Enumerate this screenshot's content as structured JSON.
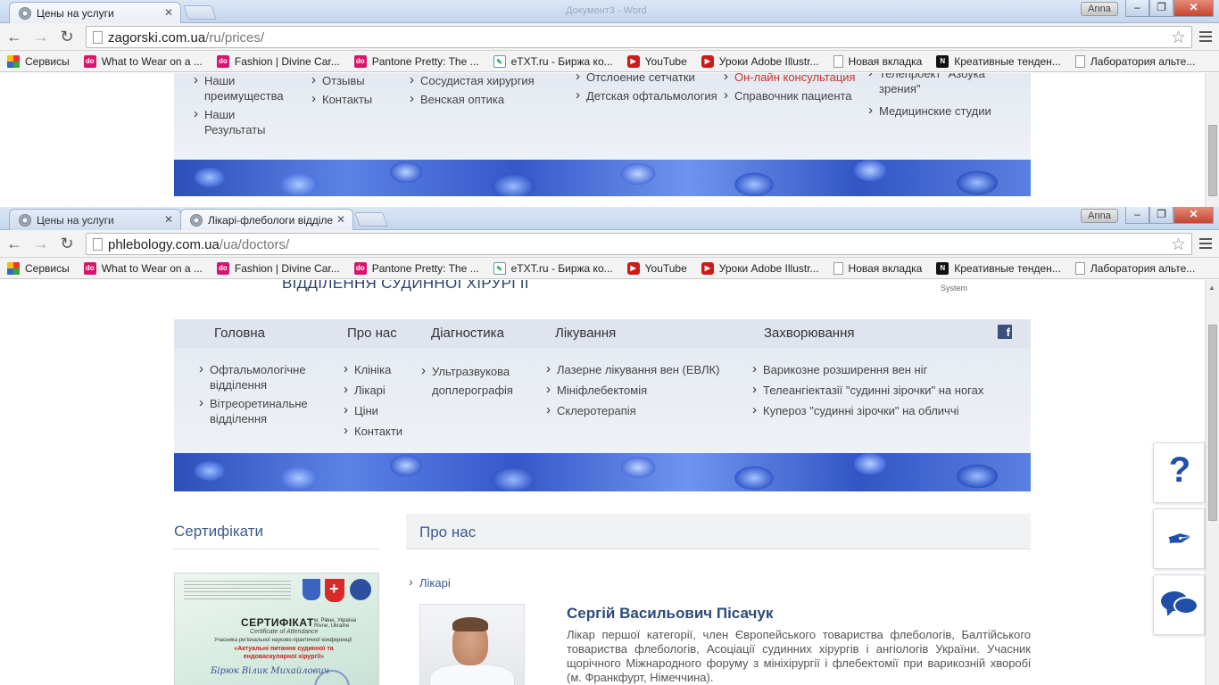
{
  "bookmarks": [
    {
      "label": "Сервисы",
      "icon": "apps-icon",
      "cls": "apps"
    },
    {
      "label": "What to Wear on a ...",
      "icon": "do-icon",
      "cls": "do"
    },
    {
      "label": "Fashion | Divine Car...",
      "icon": "do-icon",
      "cls": "do"
    },
    {
      "label": "Pantone Pretty: The ...",
      "icon": "do-icon",
      "cls": "do"
    },
    {
      "label": "eTXT.ru - Биржа ко...",
      "icon": "etxt-icon",
      "cls": "etxt"
    },
    {
      "label": "YouTube",
      "icon": "youtube-icon",
      "cls": "yt"
    },
    {
      "label": "Уроки Adobe Illustr...",
      "icon": "youtube-icon",
      "cls": "yt"
    },
    {
      "label": "Новая вкладка",
      "icon": "page-icon",
      "cls": "doc"
    },
    {
      "label": "Креативные тенден...",
      "icon": "n-icon",
      "cls": "n"
    },
    {
      "label": "Лаборатория альте...",
      "icon": "page-icon",
      "cls": "doc"
    }
  ],
  "window1": {
    "user": "Anna",
    "ghost_title": "Документ3 - Word",
    "tabs": [
      {
        "title": "Цены на услуги"
      }
    ],
    "url_host": "zagorski.com.ua",
    "url_path": "/ru/prices/",
    "menu": {
      "col1": [
        "Наши преимущества",
        "Наши Результаты"
      ],
      "col2": [
        "Отзывы",
        "Контакты"
      ],
      "col3": [
        "Сосудистая хирургия",
        "Венская оптика"
      ],
      "col4": [
        "Отслоение сетчатки",
        "Детская офтальмология"
      ],
      "col5": [
        "Он-лайн консультация",
        "Справочник пациента"
      ],
      "col6": [
        "Телепроект \"Азбука зрения\"",
        "Медицинские студии"
      ]
    }
  },
  "window2": {
    "user": "Anna",
    "tabs": [
      {
        "title": "Цены на услуги"
      },
      {
        "title": "Лікарі-флебологи відділе"
      }
    ],
    "url_host": "phlebology.com.ua",
    "url_path": "/ua/doctors/",
    "dept_title": "ВІДДІЛЕННЯ СУДИННОЇ ХІРУРГІЇ",
    "system_label": "System",
    "nav": [
      "Головна",
      "Про нас",
      "Діагностика",
      "Лікування",
      "Захворювання"
    ],
    "submenu": {
      "home": [
        "Офтальмологічне відділення",
        "Вітреоретинальне відділення"
      ],
      "about": [
        "Клініка",
        "Лікарі",
        "Ціни",
        "Контакти"
      ],
      "diagnostics": [
        "Ультразвукова доплерографія"
      ],
      "treatment": [
        "Лазерне лікування вен (ЕВЛК)",
        "Мініфлебектомія",
        "Склеротерапія"
      ],
      "diseases": [
        "Варикозне розширення вен ніг",
        "Телеангіектазії \"судинні зірочки\" на ногах",
        "Купероз \"судинні зірочки\" на обличчі"
      ]
    },
    "certificates_heading": "Сертифікати",
    "certificate": {
      "title": "СЕРТИФІКАТ",
      "subtitle": "Certificate of Attendance",
      "conference": "Учасника регіональної науково-практичної конференції",
      "topic": "«Актуальні питання судинної та ендоваскулярної хірургії»",
      "place": "м. Рівне, Україна Rivne, Ukraine",
      "signature": "Бірюк  Вілик  Михайлович"
    },
    "about_heading": "Про нас",
    "breadcrumb": "Лікарі",
    "doctor": {
      "name": "Сергій Васильович Пісачук",
      "bio": "Лікар першої категорії, член Європейського товариства флебологів, Балтійського товариства флебологів, Асоціації судинних хірургів і ангіологів України. Учасник щорічного Міжнародного форуму з мініхірургії і флебектомії при варикозній хворобі (м. Франкфурт, Німеччина)."
    },
    "widgets": [
      "question-icon",
      "pen-icon",
      "chat-icon"
    ]
  }
}
